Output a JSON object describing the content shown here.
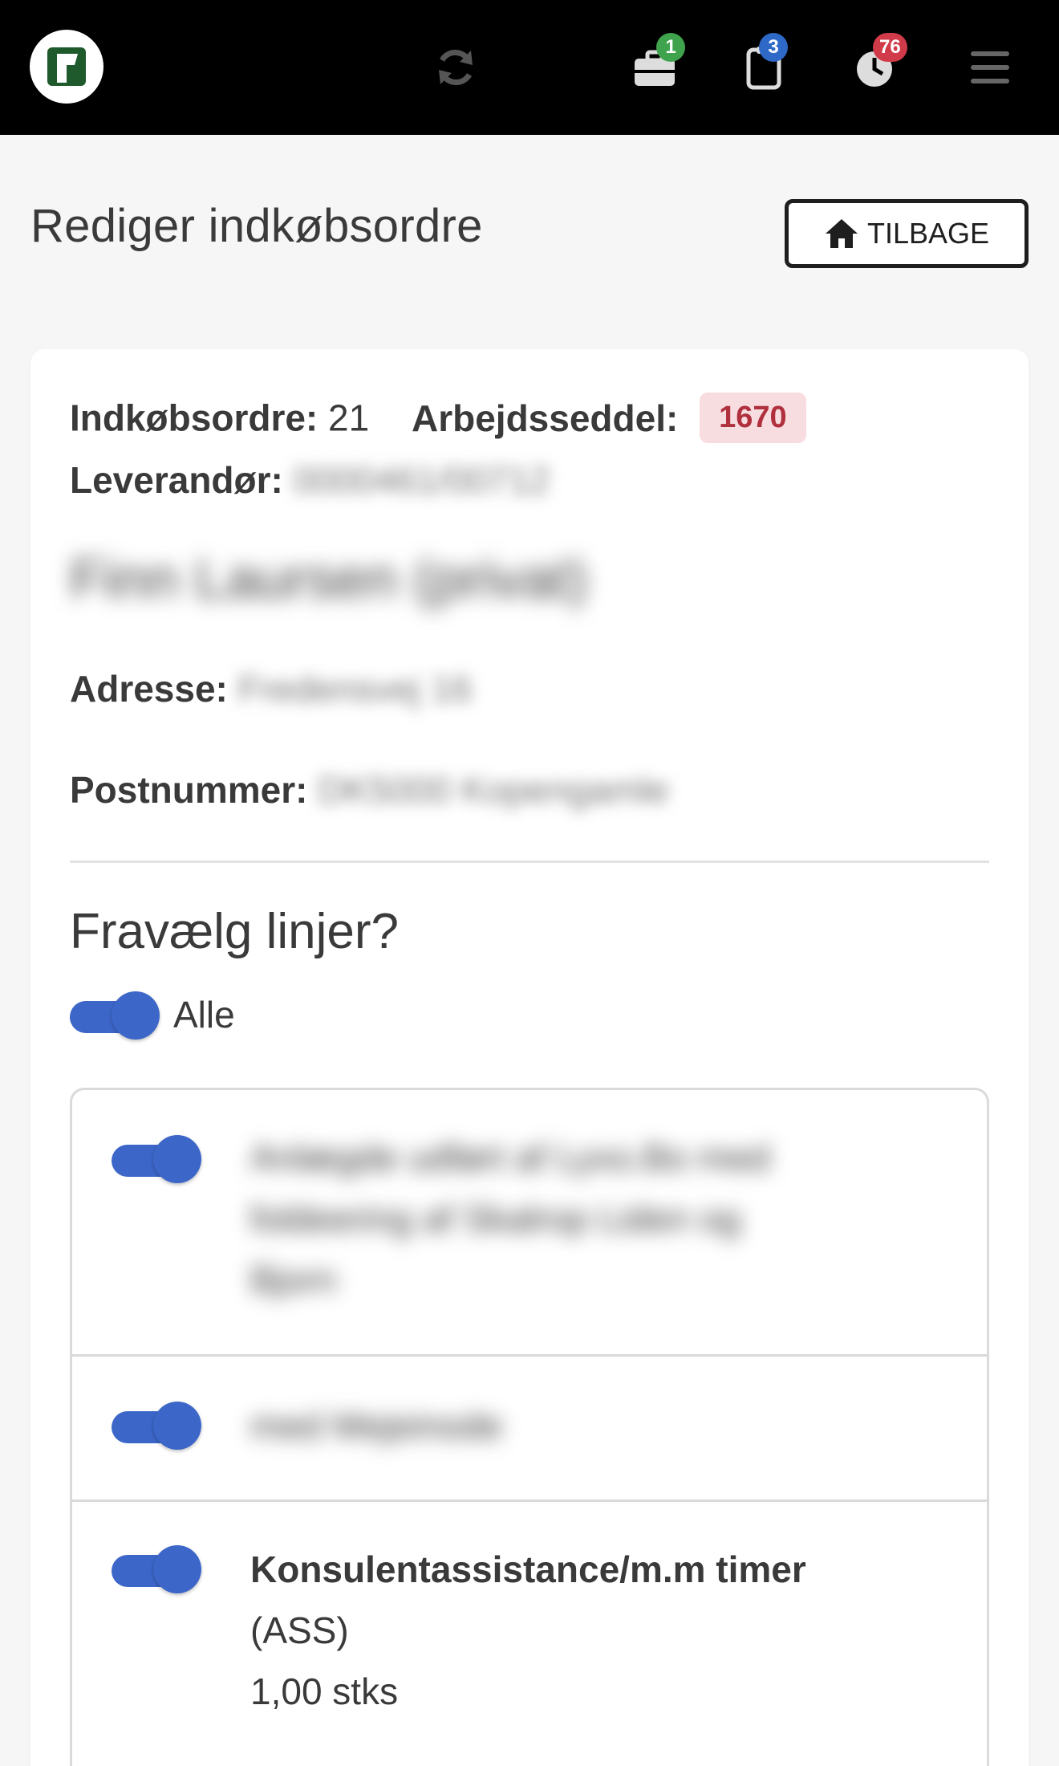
{
  "header": {
    "logo_icon": "brand-logo-icon",
    "sync_icon": "sync-icon",
    "briefcase_badge": "1",
    "clipboard_badge": "3",
    "clock_badge": "76",
    "menu_icon": "hamburger-menu-icon",
    "colors": {
      "bar": "#000000",
      "green": "#3fa34d",
      "blue": "#2f69c8",
      "red": "#d13a48"
    }
  },
  "page": {
    "title": "Rediger indkøbsordre",
    "back_label": "TILBAGE"
  },
  "order": {
    "po_label": "Indkøbsordre:",
    "po_value": "21",
    "worksheet_label": "Arbejdsseddel:",
    "worksheet_value": "1670",
    "supplier_label": "Leverandør:",
    "supplier_value": "0000461/00712",
    "supplier_name": "Finn Laursen (privat)",
    "address_label": "Adresse:",
    "address_value": "Fredensvej 16",
    "postal_label": "Postnummer:",
    "postal_value": "DK5000 Kopengamle"
  },
  "deselect": {
    "title": "Fravælg linjer?",
    "all_label": "Alle",
    "lines": [
      {
        "text": "Anlægde udført af Lyxo.Bo med",
        "text2": "foldeering af Skalrop Liden og",
        "text3": "Bjorn"
      },
      {
        "text": "med Mejeinode"
      },
      {
        "text": "Konsulentassistance/m.m timer",
        "code": "(ASS)",
        "qty": "1,00 stks"
      }
    ]
  }
}
